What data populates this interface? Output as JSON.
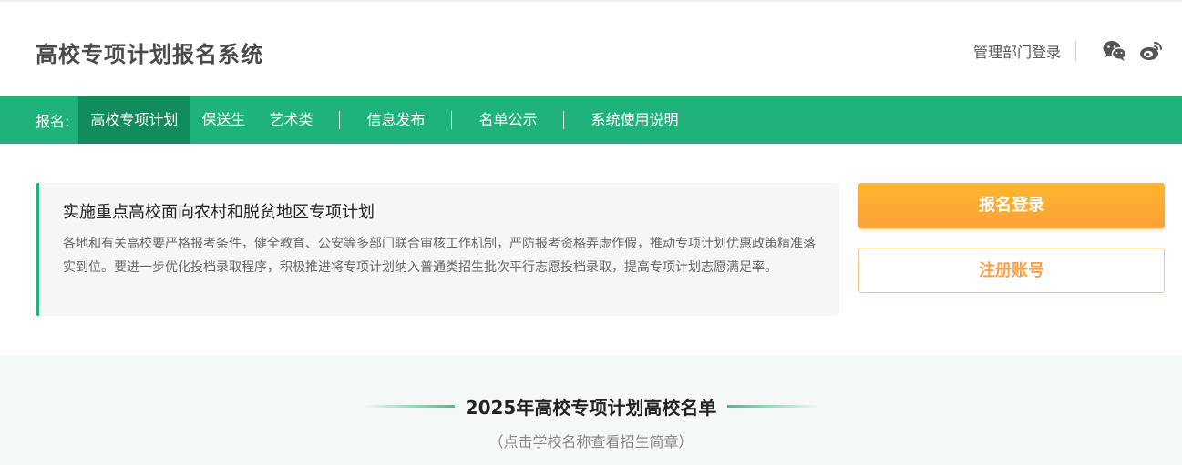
{
  "header": {
    "site_title": "高校专项计划报名系统",
    "admin_login": "管理部门登录",
    "icons": [
      "wechat-icon",
      "weibo-icon"
    ]
  },
  "nav": {
    "prefix": "报名:",
    "items": [
      {
        "label": "高校专项计划",
        "active": true
      },
      {
        "label": "保送生"
      },
      {
        "label": "艺术类"
      },
      {
        "label": "信息发布"
      },
      {
        "label": "名单公示"
      },
      {
        "label": "系统使用说明"
      }
    ]
  },
  "notice": {
    "title": "实施重点高校面向农村和脱贫地区专项计划",
    "body": "各地和有关高校要严格报考条件，健全教育、公安等多部门联合审核工作机制，严防报考资格弄虚作假，推动专项计划优惠政策精准落实到位。要进一步优化投档录取程序，积极推进将专项计划纳入普通类招生批次平行志愿投档录取，提高专项计划志愿满足率。"
  },
  "buttons": {
    "login": "报名登录",
    "register": "注册账号"
  },
  "section": {
    "title": "2025年高校专项计划高校名单",
    "subtitle": "（点击学校名称查看招生简章）"
  },
  "colors": {
    "brand_green": "#1fb27a",
    "active_green": "#128b5d",
    "accent_orange": "#fba137"
  }
}
